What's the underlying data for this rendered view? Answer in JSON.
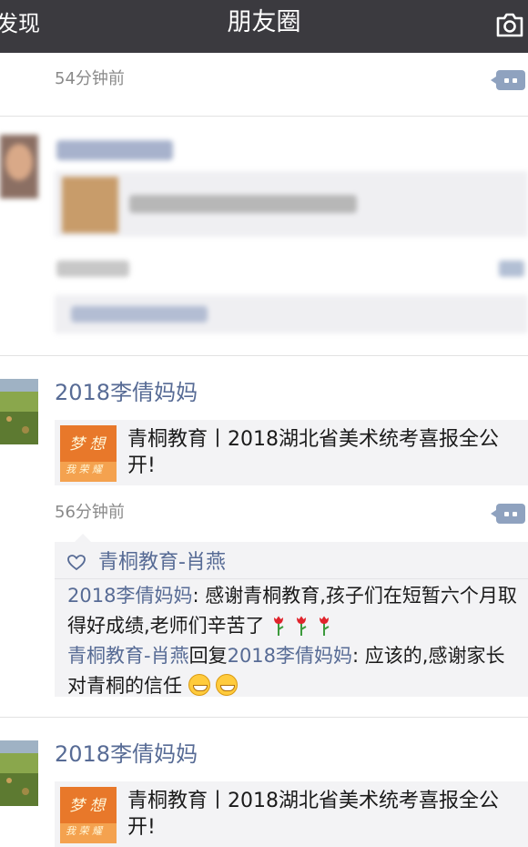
{
  "nav": {
    "back_label": "发现",
    "title": "朋友圈",
    "camera_icon": "camera-icon"
  },
  "colors": {
    "navbar": "#3b3a3f",
    "link_blue": "#576b95",
    "card_bg": "#f3f3f5",
    "time_gray": "#8a8a8a"
  },
  "post_top": {
    "time": "54分钟前"
  },
  "post1": {
    "username": "2018李倩妈妈",
    "link_text": "青桐教育丨2018湖北省美术统考喜报全公开!",
    "time": "56分钟前",
    "likes": [
      "青桐教育-肖燕"
    ],
    "comments": [
      {
        "name": "2018李倩妈妈",
        "text": ": 感谢青桐教育,孩子们在短暂六个月取得好成绩,老师们辛苦了"
      },
      {
        "name": "青桐教育-肖燕",
        "reply_word": "回复",
        "reply_to": "2018李倩妈妈",
        "text": ": 应该的,感谢家长对青桐的信任"
      }
    ]
  },
  "post2": {
    "username": "2018李倩妈妈",
    "link_text": "青桐教育丨2018湖北省美术统考喜报全公开!"
  }
}
